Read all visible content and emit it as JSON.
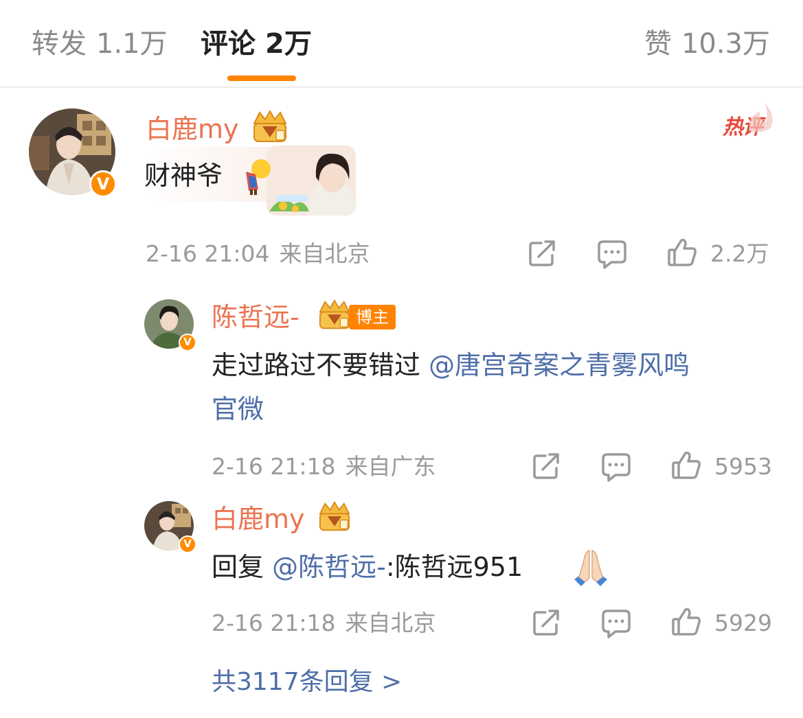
{
  "tabs": {
    "forward": {
      "label": "转发",
      "count": "1.1万"
    },
    "comment": {
      "label": "评论",
      "count": "2万"
    },
    "like": {
      "label": "赞",
      "count": "10.3万"
    }
  },
  "comment": {
    "user": "白鹿my",
    "hot_tag": "热评",
    "text": "财神爷",
    "time": "2-16 21:04",
    "location": "来自北京",
    "likes": "2.2万"
  },
  "replies": [
    {
      "user": "陈哲远-",
      "badge": "博主",
      "text": "走过路过不要错过",
      "mention_line1": "@唐宫奇案之青雾风鸣",
      "mention_line2": "官微",
      "time": "2-16 21:18",
      "location": "来自广东",
      "likes": "5953"
    },
    {
      "user": "白鹿my",
      "prefix": "回复",
      "mention": "@陈哲远-",
      "text": ":陈哲远951",
      "time": "2-16 21:18",
      "location": "来自北京",
      "likes": "5929"
    }
  ],
  "more_replies": "共3117条回复 >",
  "colors": {
    "accent": "#ff8200",
    "username": "#eb7350",
    "link": "#4e6ea8",
    "meta": "#9a9a9a",
    "hot": "#e8483a"
  },
  "icons": [
    "share-icon",
    "comment-icon",
    "thumbs-up-icon",
    "crown-badge-icon",
    "verified-v-icon",
    "pray-hands-emoji",
    "bowing-emoji"
  ]
}
